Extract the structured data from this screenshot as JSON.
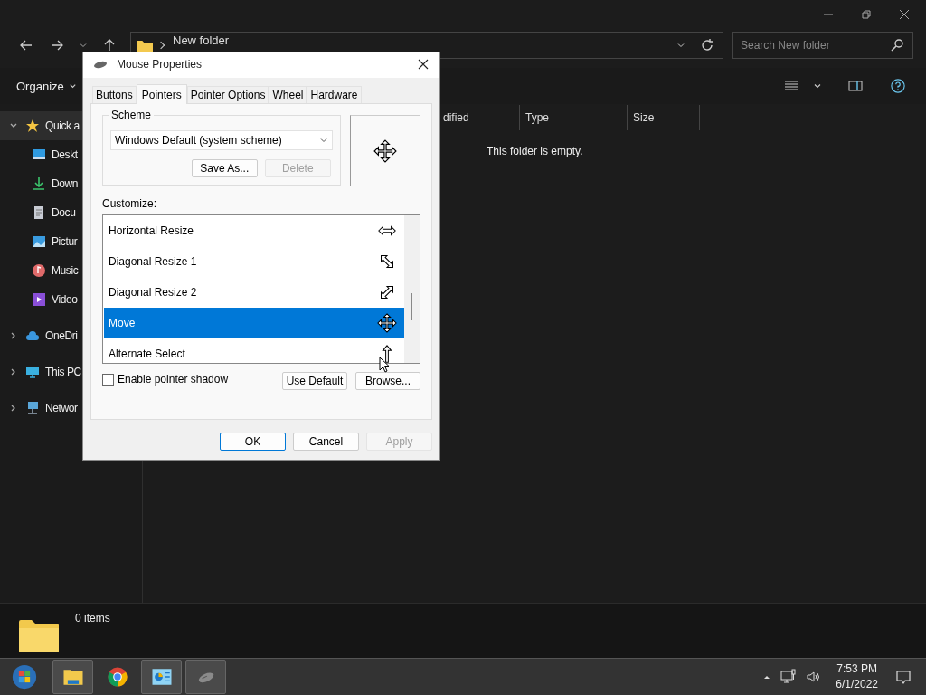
{
  "explorer": {
    "breadcrumb": "New folder",
    "search": {
      "placeholder": "Search New folder"
    },
    "organize": "Organize",
    "sidebar": [
      {
        "label": "Quick a",
        "kind": "star",
        "expanded": true,
        "selected": true,
        "children": [
          {
            "label": "Deskt",
            "kind": "desktop"
          },
          {
            "label": "Down",
            "kind": "download"
          },
          {
            "label": "Docu",
            "kind": "document"
          },
          {
            "label": "Pictur",
            "kind": "pictures"
          },
          {
            "label": "Music",
            "kind": "music"
          },
          {
            "label": "Video",
            "kind": "video"
          }
        ]
      },
      {
        "label": "OneDri",
        "kind": "cloud",
        "expanded": false,
        "selected": false
      },
      {
        "label": "This PC",
        "kind": "pc",
        "expanded": false,
        "selected": false
      },
      {
        "label": "Networ",
        "kind": "network",
        "expanded": false,
        "selected": false
      }
    ],
    "columns": [
      "dified",
      "Type",
      "Size"
    ],
    "empty_message": "This folder is empty.",
    "status": "0 items"
  },
  "dialog": {
    "title": "Mouse Properties",
    "tabs": [
      {
        "label": "Buttons",
        "selected": false
      },
      {
        "label": "Pointers",
        "selected": true
      },
      {
        "label": "Pointer Options",
        "selected": false
      },
      {
        "label": "Wheel",
        "selected": false
      },
      {
        "label": "Hardware",
        "selected": false
      }
    ],
    "scheme": {
      "label": "Scheme",
      "value": "Windows Default (system scheme)",
      "buttons": [
        {
          "label": "Save As...",
          "disabled": false
        },
        {
          "label": "Delete",
          "disabled": true
        }
      ]
    },
    "customize_label": "Customize:",
    "pointers": [
      {
        "name": "Horizontal Resize",
        "kind": "hresize",
        "selected": false
      },
      {
        "name": "Diagonal Resize 1",
        "kind": "diag1",
        "selected": false
      },
      {
        "name": "Diagonal Resize 2",
        "kind": "diag2",
        "selected": false
      },
      {
        "name": "Move",
        "kind": "move",
        "selected": true
      },
      {
        "name": "Alternate Select",
        "kind": "alternate",
        "selected": false
      }
    ],
    "shadow": {
      "label": "Enable pointer shadow",
      "checked": false
    },
    "list_buttons": [
      "Use Default",
      "Browse..."
    ],
    "buttons": [
      {
        "label": "OK",
        "default": true,
        "disabled": false
      },
      {
        "label": "Cancel",
        "default": false,
        "disabled": false
      },
      {
        "label": "Apply",
        "default": false,
        "disabled": true
      }
    ]
  },
  "taskbar": {
    "apps": [
      {
        "kind": "start",
        "active": false
      },
      {
        "kind": "explorer",
        "active": true
      },
      {
        "kind": "chrome",
        "active": false
      },
      {
        "kind": "control-panel",
        "active": true
      },
      {
        "kind": "mouse",
        "active": true
      }
    ],
    "time": "7:53 PM",
    "date": "6/1/2022"
  }
}
